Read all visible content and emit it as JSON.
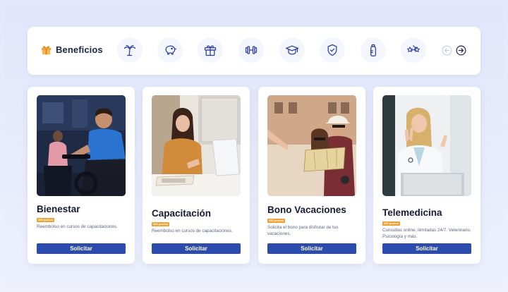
{
  "header": {
    "title": "Beneficios",
    "icons": [
      "palm-tree-icon",
      "piggy-bank-icon",
      "gift-icon",
      "dumbbell-icon",
      "graduation-cap-icon",
      "shield-check-icon",
      "baby-bottle-icon",
      "stars-icon"
    ]
  },
  "colors": {
    "primary": "#2c4cad",
    "badge": "#f0a030",
    "icon": "#2c3f9e",
    "text": "#151b33"
  },
  "cards": [
    {
      "title": "Bienestar",
      "badge": "350 puntos",
      "description": "Reembolso en cursos de capacitaciones.",
      "cta": "Solicitar"
    },
    {
      "title": "Capacitación",
      "badge": "350 puntos",
      "description": "Reembolso en cursos de capacitaciones.",
      "cta": "Solicitar"
    },
    {
      "title": "Bono Vacaciones",
      "badge": "350 puntos",
      "description": "Solicita el bono para disfrutar de tus vacaciones.",
      "cta": "Solicitar"
    },
    {
      "title": "Telemedicina",
      "badge": "350 puntos",
      "description": "Consultas online, ilimitadas 24/7. Veterinario, Psicología y más.",
      "cta": "Solicitar"
    }
  ]
}
